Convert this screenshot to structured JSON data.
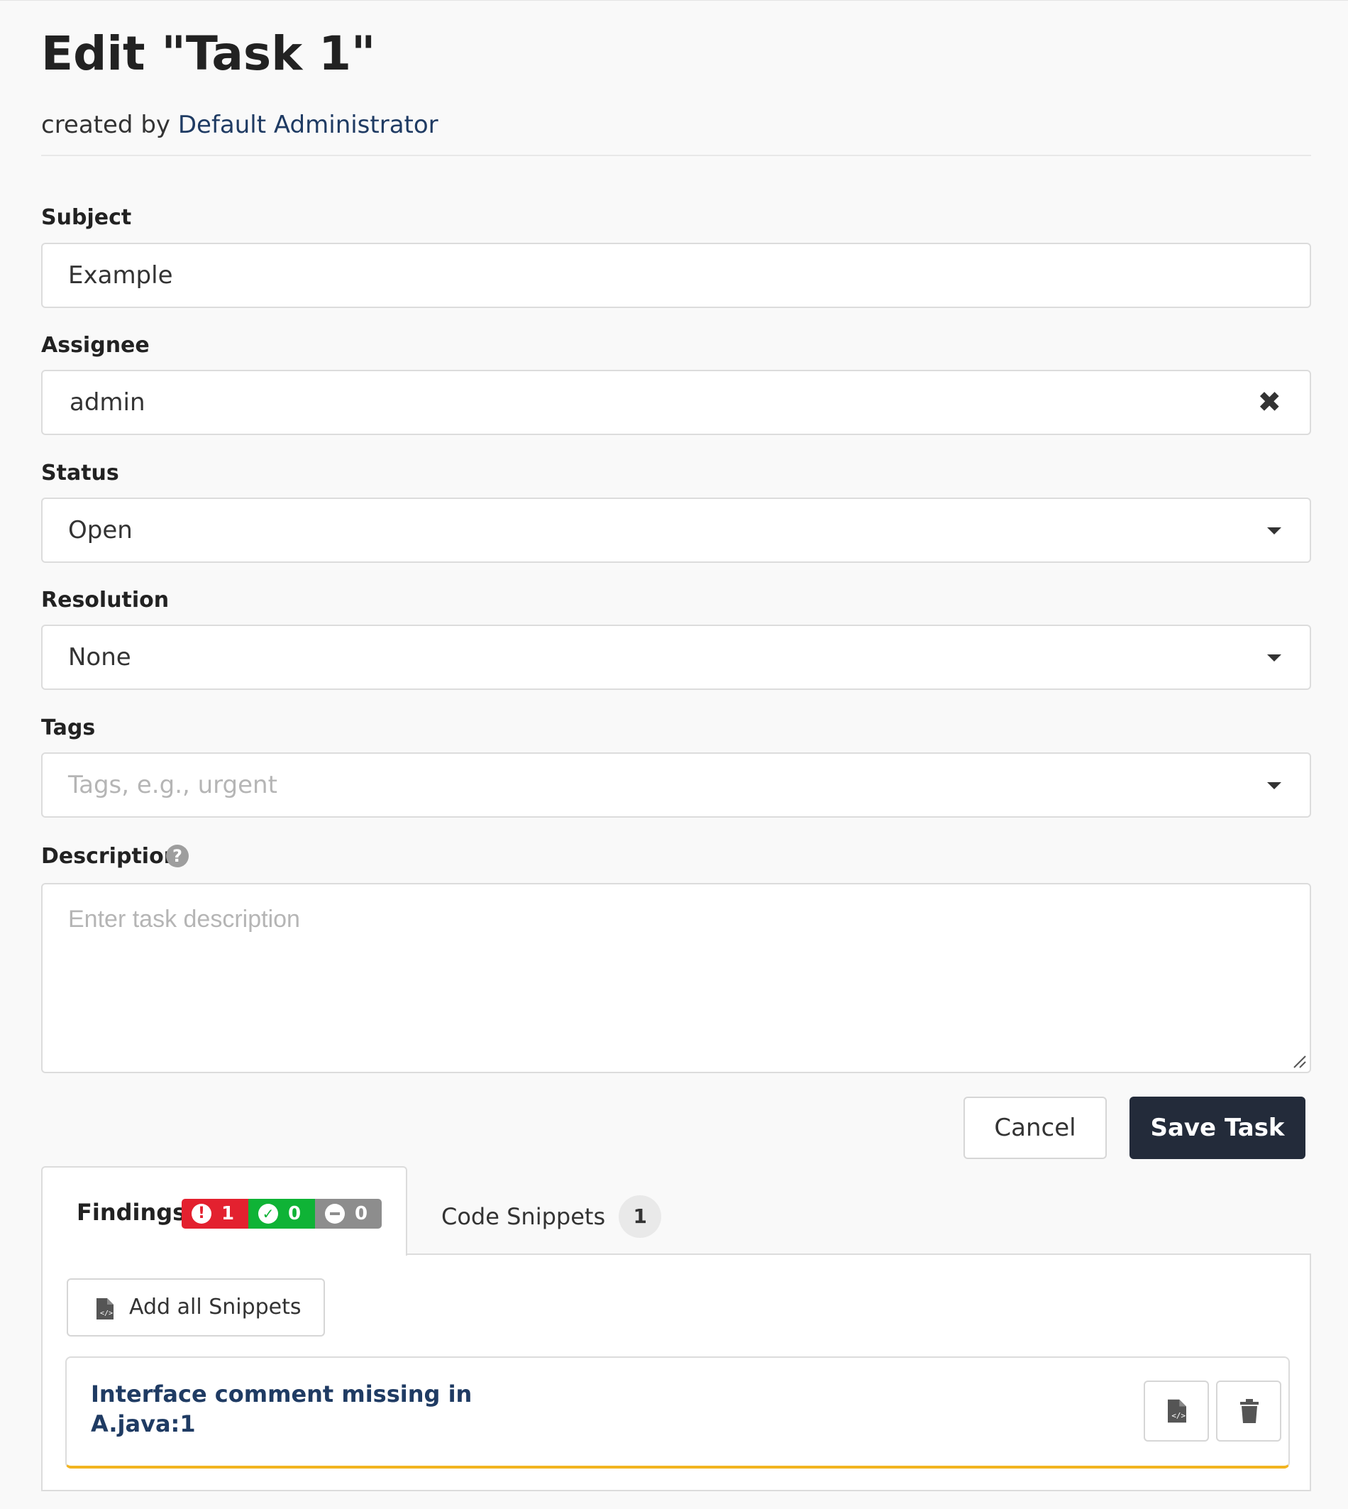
{
  "header": {
    "title": "Edit \"Task 1\"",
    "created_prefix": "created by",
    "creator": "Default Administrator"
  },
  "form": {
    "subject": {
      "label": "Subject",
      "value": "Example"
    },
    "assignee": {
      "label": "Assignee",
      "value": "admin",
      "clear_icon": "close-icon"
    },
    "status": {
      "label": "Status",
      "value": "Open"
    },
    "resolution": {
      "label": "Resolution",
      "value": "None"
    },
    "tags": {
      "label": "Tags",
      "placeholder": "Tags, e.g., urgent"
    },
    "description": {
      "label": "Description",
      "placeholder": "Enter task description",
      "help_icon": "question-circle-icon",
      "help_glyph": "?"
    }
  },
  "actions": {
    "cancel_label": "Cancel",
    "save_label": "Save Task"
  },
  "tabs": {
    "findings": {
      "label": "Findings",
      "badges": [
        {
          "icon": "exclamation-circle-icon",
          "count": "1",
          "color": "#e3212f"
        },
        {
          "icon": "check-circle-icon",
          "count": "0",
          "color": "#0fb336"
        },
        {
          "icon": "minus-circle-icon",
          "count": "0",
          "color": "#8d8d8d"
        }
      ]
    },
    "code_snippets": {
      "label": "Code Snippets",
      "count": "1"
    }
  },
  "findings_panel": {
    "add_all_label": "Add all Snippets",
    "items": [
      {
        "title": "Interface comment missing in A.java:1",
        "accent": "#f2b420"
      }
    ]
  },
  "colors": {
    "primary_button": "#232b3a",
    "link": "#1f3b63"
  }
}
